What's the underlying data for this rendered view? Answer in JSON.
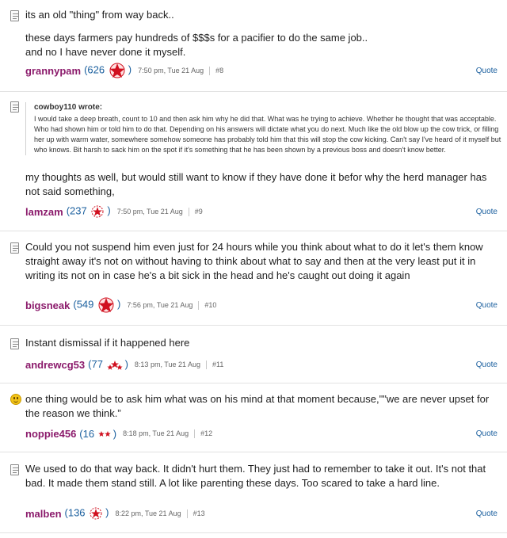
{
  "posts": [
    {
      "icon": "document-icon",
      "lines": [
        "its an old \"thing\" from way back..",
        "",
        "these days farmers pay hundreds of $$$s for a pacifier to do the same job..",
        "and no I have never done it myself."
      ],
      "username": "grannypam",
      "score_open": "(626",
      "score_close": ")",
      "time": "7:50 pm, Tue 21 Aug",
      "post_number": "#8",
      "quote_label": "Quote"
    },
    {
      "icon": "document-icon",
      "quote_author": "cowboy110 wrote:",
      "quote_text": "I would take a deep breath, count to 10 and then ask him why he did that. What was he trying to achieve. Whether he thought that was acceptable. Who had shown him or told him to do that. Depending on his answers will dictate what you do next. Much like the old blow up the cow trick, or filling her up with warm water, somewhere somehow someone has probably told him that this will stop the cow kicking. Can't say I've heard of it myself but who knows. Bit harsh to sack him on the spot if it's something that he has been shown by a previous boss and doesn't know better.",
      "text": "my thoughts as well, but would still want to know if they have done it befor why the herd manager has not said something,",
      "username": "lamzam",
      "score_open": "(237",
      "score_close": ")",
      "time": "7:50 pm, Tue 21 Aug",
      "post_number": "#9",
      "quote_label": "Quote"
    },
    {
      "icon": "document-icon",
      "text": "Could you not suspend him even just for 24 hours while you think about what to do it let's them know straight away it's not on without having to think about what to say and then at the very least put it in writing its not on in case he's a bit sick in the head and he's caught out doing it again",
      "username": "bigsneak",
      "score_open": "(549",
      "score_close": ")",
      "time": "7:56 pm, Tue 21 Aug",
      "post_number": "#10",
      "quote_label": "Quote"
    },
    {
      "icon": "document-icon",
      "text": "Instant dismissal if it happened here",
      "username": "andrewcg53",
      "score_open": "(77",
      "score_close": ")",
      "time": "8:13 pm, Tue 21 Aug",
      "post_number": "#11",
      "quote_label": "Quote"
    },
    {
      "icon": "smiley-icon",
      "text": "one thing would be to ask him what was on his mind at that moment because,\"\"we are never upset for the reason we think.”",
      "username": "noppie456",
      "score_open": "(16",
      "score_close": ")",
      "time": "8:18 pm, Tue 21 Aug",
      "post_number": "#12",
      "quote_label": "Quote"
    },
    {
      "icon": "document-icon",
      "text": "We used to do that way back. It didn't hurt them. They just had to remember to take it out. It's not that bad. It made them stand still. A lot like parenting these days. Too scared to take a hard line.",
      "username": "malben",
      "score_open": "(136",
      "score_close": ")",
      "time": "8:22 pm, Tue 21 Aug",
      "post_number": "#13",
      "quote_label": "Quote"
    }
  ],
  "colors": {
    "username": "#8b1a6b",
    "link": "#1a5f9e",
    "badge_red": "#d0101f"
  }
}
